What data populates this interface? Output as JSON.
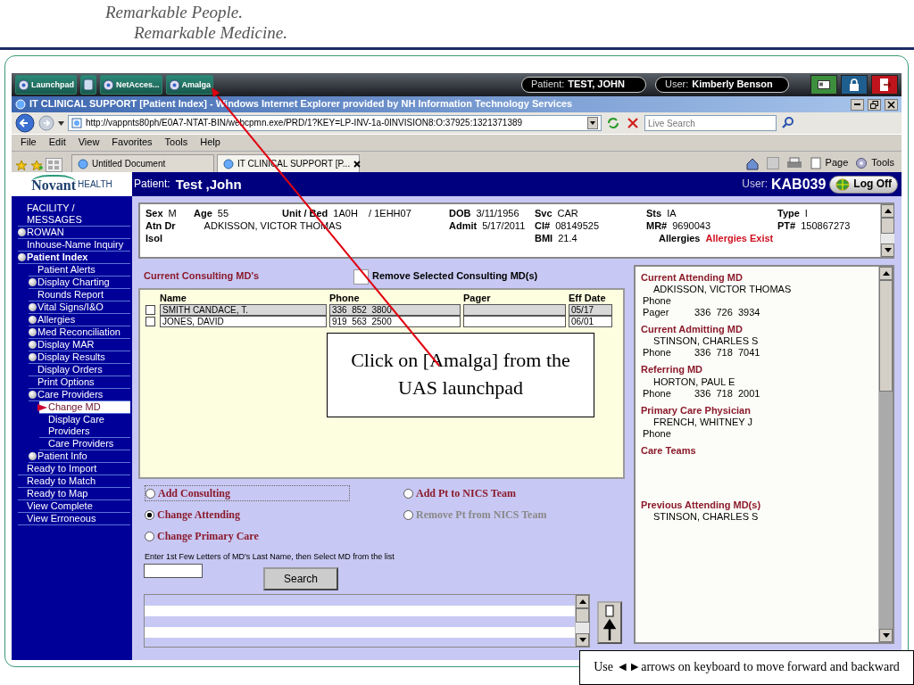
{
  "slide": {
    "tagline": [
      "Remarkable People.",
      "Remarkable Medicine."
    ],
    "callout": "Click on [Amalga] from the UAS launchpad",
    "footer_note": "Use ◄►arrows on keyboard to move forward and backward"
  },
  "launchpad": {
    "apps": [
      {
        "kind": "app",
        "label": "Launchpad"
      },
      {
        "kind": "icon"
      },
      {
        "kind": "app",
        "label": "NetAcces..."
      },
      {
        "kind": "app",
        "label": "Amalga"
      }
    ],
    "patient": {
      "label": "Patient:",
      "value": "TEST, JOHN"
    },
    "user": {
      "label": "User:",
      "value": "Kimberly Benson"
    }
  },
  "browser": {
    "title": "IT CLINICAL SUPPORT [Patient Index] - Windows Internet Explorer provided by NH Information Technology Services",
    "url": "http://vappnts80ph/E0A7-NTAT-BIN/webcpmn.exe/PRD/1?KEY=LP-INV-1a-0INVISION8:O:37925:1321371389",
    "search_placeholder": "Live Search",
    "menu": [
      "File",
      "Edit",
      "View",
      "Favorites",
      "Tools",
      "Help"
    ],
    "tabs": [
      {
        "label": "Untitled Document",
        "selected": false
      },
      {
        "label": "IT CLINICAL SUPPORT [P...",
        "selected": true
      }
    ],
    "commands": [
      "Page",
      "Tools"
    ]
  },
  "app": {
    "logo": {
      "name": "Novant",
      "suffix": "HEALTH"
    },
    "patient_label": "Patient:",
    "patient_name": "Test ,John",
    "user_label": "User:",
    "user_id": "KAB039",
    "logoff": "Log Off"
  },
  "sidebar": {
    "items": [
      {
        "label": "FACILITY / MESSAGES",
        "kind": "link"
      },
      {
        "label": "ROWAN",
        "kind": "folder"
      },
      {
        "label": "Inhouse-Name Inquiry",
        "kind": "link"
      },
      {
        "label": "Patient Index",
        "kind": "folder",
        "children": [
          {
            "label": "Patient Alerts",
            "kind": "link"
          },
          {
            "label": "Display Charting",
            "kind": "folder"
          },
          {
            "label": "Rounds Report",
            "kind": "link"
          },
          {
            "label": "Vital Signs/I&O",
            "kind": "folder"
          },
          {
            "label": "Allergies",
            "kind": "folder"
          },
          {
            "label": "Med Reconciliation",
            "kind": "folder"
          },
          {
            "label": "Display MAR",
            "kind": "folder"
          },
          {
            "label": "Display Results",
            "kind": "folder"
          },
          {
            "label": "Display Orders",
            "kind": "link"
          },
          {
            "label": "Print Options",
            "kind": "link"
          },
          {
            "label": "Care Providers",
            "kind": "folder",
            "children": [
              {
                "label": "Change MD",
                "kind": "link",
                "selected": true
              },
              {
                "label": "Display Care Providers",
                "kind": "link",
                "selected": false
              },
              {
                "label": "Care Providers",
                "kind": "link",
                "selected": false
              }
            ]
          },
          {
            "label": "Patient Info",
            "kind": "folder"
          }
        ]
      },
      {
        "label": "Ready to Import",
        "kind": "link"
      },
      {
        "label": "Ready to Match",
        "kind": "link"
      },
      {
        "label": "Ready to Map",
        "kind": "link"
      },
      {
        "label": "View Complete",
        "kind": "link"
      },
      {
        "label": "View Erroneous",
        "kind": "link"
      }
    ]
  },
  "patient_header": {
    "fields": [
      {
        "label": "Sex",
        "value": "M"
      },
      {
        "label": "Age",
        "value": "55"
      },
      {
        "label": "Unit / Bed",
        "value": "1A0H    / 1EHH07"
      },
      {
        "label": "DOB",
        "value": "3/11/1956"
      },
      {
        "label": "Svc",
        "value": "CAR"
      },
      {
        "label": "Sts",
        "value": "IA"
      },
      {
        "label": "Type",
        "value": "I"
      },
      {
        "label": "Atn Dr",
        "value": "ADKISSON, VICTOR THOMAS"
      },
      {
        "label": "Admit",
        "value": "5/17/2011"
      },
      {
        "label": "CI#",
        "value": "08149525"
      },
      {
        "label": "MR#",
        "value": "9690043"
      },
      {
        "label": "PT#",
        "value": "150867273"
      },
      {
        "label": "Isol"
      },
      {
        "label": "BMI",
        "value": "21.4"
      },
      {
        "label": "Allergies",
        "value": "Allergies Exist",
        "alert": true
      }
    ]
  },
  "consulting": {
    "title": "Current Consulting MD's",
    "remove_label": "Remove Selected Consulting MD(s)",
    "columns": [
      "Name",
      "Phone",
      "Pager",
      "Eff Date"
    ],
    "rows": [
      {
        "checked": false,
        "cells": [
          "SMITH CANDACE, T.",
          "336  852  3800",
          "",
          "05/17"
        ]
      },
      {
        "checked": false,
        "cells": [
          "JONES, DAVID",
          "919  563  2500",
          "",
          "06/01"
        ]
      }
    ]
  },
  "options": [
    {
      "label": "Add Consulting",
      "selected": false,
      "disabled": false
    },
    {
      "label": "Change Attending",
      "selected": true,
      "disabled": false
    },
    {
      "label": "Change Primary Care",
      "selected": false,
      "disabled": false
    },
    {
      "label": "Add Pt to NICS Team",
      "selected": false,
      "disabled": false
    },
    {
      "label": "Remove Pt from NICS Team",
      "selected": false,
      "disabled": true
    }
  ],
  "instructions": "Enter 1st Few Letters of MD's Last Name, then Select MD from the list",
  "search_button": "Search",
  "care_team": [
    {
      "title": "Current Attending MD",
      "name": "ADKISSON, VICTOR THOMAS",
      "lines": [
        {
          "label": "Phone"
        },
        {
          "label": "Pager",
          "value": "336  726  3934"
        }
      ]
    },
    {
      "title": "Current Admitting MD",
      "name": "STINSON, CHARLES S",
      "lines": [
        {
          "label": "Phone",
          "value": "336  718  7041"
        }
      ]
    },
    {
      "title": "Referring MD",
      "name": "HORTON, PAUL E",
      "lines": [
        {
          "label": "Phone",
          "value": "336  718  2001"
        }
      ]
    },
    {
      "title": "Primary Care Physician",
      "name": "FRENCH, WHITNEY J",
      "lines": [
        {
          "label": "Phone"
        }
      ]
    },
    {
      "title": "Care Teams"
    },
    {
      "title": "Previous Attending MD(s)",
      "name": "STINSON, CHARLES S"
    }
  ]
}
